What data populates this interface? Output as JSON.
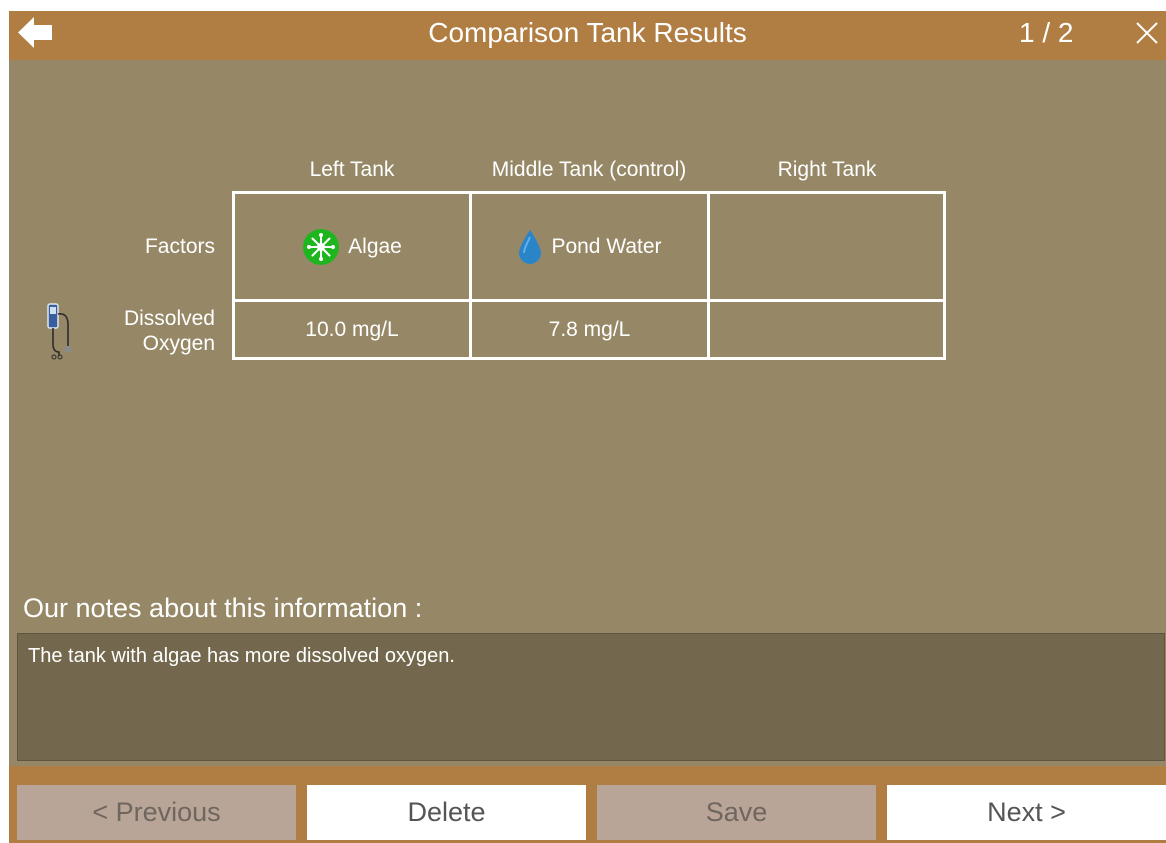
{
  "header": {
    "title": "Comparison Tank Results",
    "page_indicator": "1 / 2",
    "back_icon": "back-arrow-icon",
    "close_icon": "close-x-icon"
  },
  "table": {
    "columns": [
      "Left Tank",
      "Middle Tank (control)",
      "Right Tank"
    ],
    "rows": {
      "factors": {
        "label": "Factors",
        "cells": [
          {
            "icon": "algae-icon",
            "text": "Algae"
          },
          {
            "icon": "water-drop-icon",
            "text": "Pond Water"
          },
          {
            "icon": "",
            "text": ""
          }
        ]
      },
      "dissolved_oxygen": {
        "label_line1": "Dissolved",
        "label_line2": "Oxygen",
        "icon": "oxygen-meter-icon",
        "cells": [
          "10.0 mg/L",
          "7.8 mg/L",
          ""
        ]
      }
    }
  },
  "notes": {
    "heading": "Our notes about this information :",
    "text": "The tank with algae has more dissolved oxygen."
  },
  "buttons": {
    "previous": "< Previous",
    "delete": "Delete",
    "save": "Save",
    "next": "Next >"
  },
  "colors": {
    "header_bar": "#b07d42",
    "panel_background": "#968866",
    "notes_background": "#73684d",
    "button_disabled": "#b9a597",
    "button_enabled": "#ffffff",
    "algae_green": "#1fb51f",
    "water_blue": "#2a85c8"
  }
}
